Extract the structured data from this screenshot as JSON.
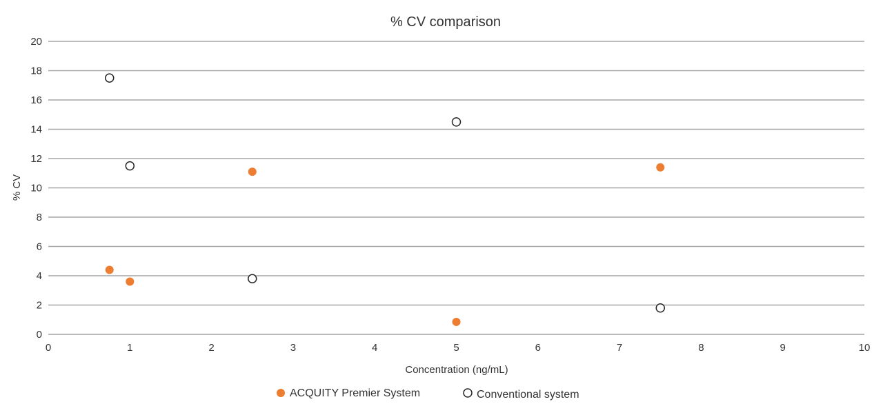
{
  "chart_data": {
    "type": "scatter",
    "title": "% CV comparison",
    "xlabel": "Concentration (ng/mL)",
    "ylabel": "% CV",
    "xlim": [
      0,
      10
    ],
    "ylim": [
      0,
      20
    ],
    "xticks": [
      0,
      1,
      2,
      3,
      4,
      5,
      6,
      7,
      8,
      9,
      10
    ],
    "yticks": [
      0,
      2,
      4,
      6,
      8,
      10,
      12,
      14,
      16,
      18,
      20
    ],
    "grid": "horizontal",
    "legend_position": "bottom-center",
    "series": [
      {
        "name": "ACQUITY Premier System",
        "marker": "filled-circle",
        "color": "#ed7d31",
        "points": [
          {
            "x": 0.75,
            "y": 4.4
          },
          {
            "x": 1,
            "y": 3.6
          },
          {
            "x": 2.5,
            "y": 11.1
          },
          {
            "x": 5,
            "y": 0.85
          },
          {
            "x": 7.5,
            "y": 11.4
          }
        ]
      },
      {
        "name": "Conventional system",
        "marker": "open-circle",
        "color": "#262626",
        "points": [
          {
            "x": 0.75,
            "y": 17.5
          },
          {
            "x": 1,
            "y": 11.5
          },
          {
            "x": 2.5,
            "y": 3.8
          },
          {
            "x": 5,
            "y": 14.5
          },
          {
            "x": 7.5,
            "y": 1.8
          }
        ]
      }
    ]
  }
}
